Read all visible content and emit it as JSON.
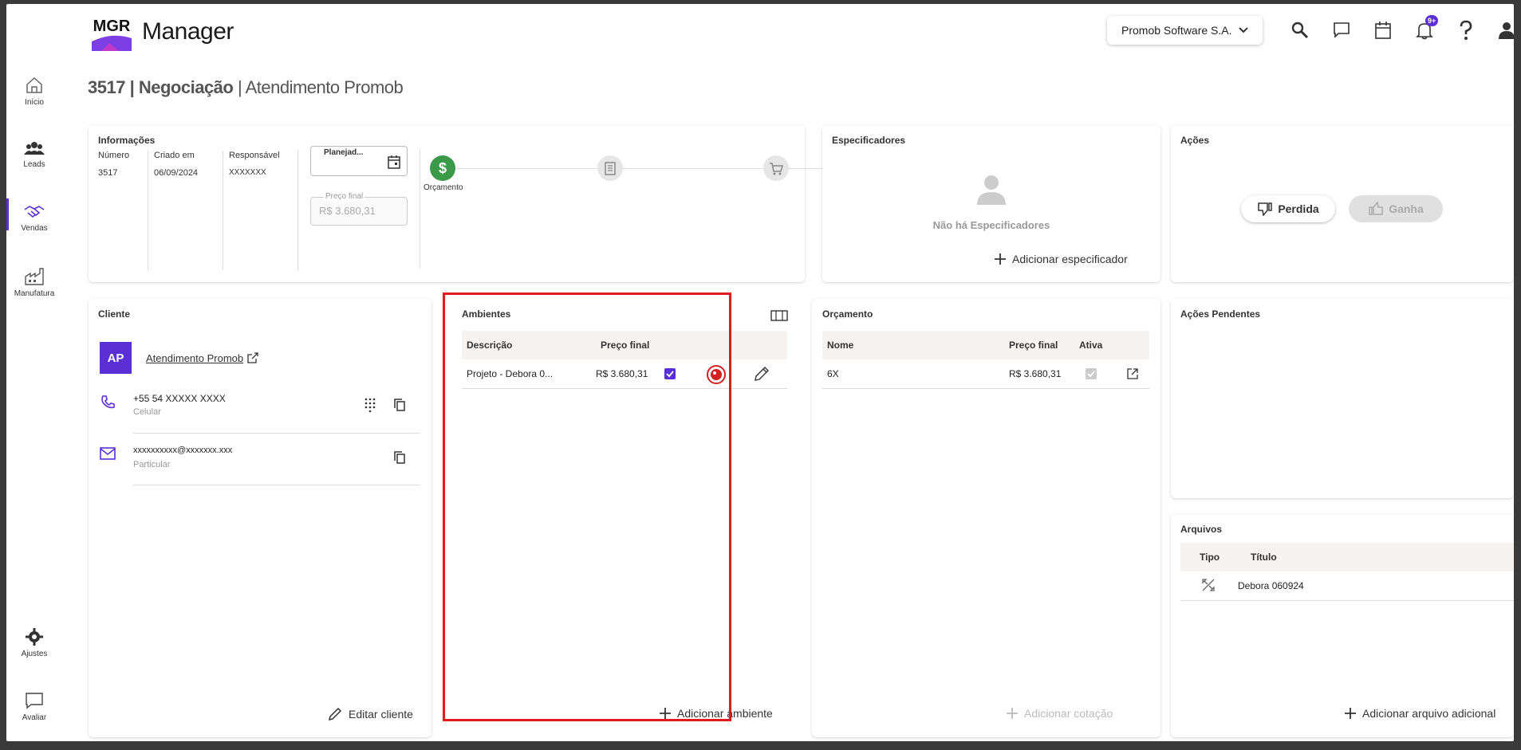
{
  "app": {
    "logo_text": "MGR",
    "title": "Manager"
  },
  "header": {
    "company": "Promob Software S.A.",
    "notifications_badge": "9+"
  },
  "nav": [
    {
      "label": "Início"
    },
    {
      "label": "Leads"
    },
    {
      "label": "Vendas"
    },
    {
      "label": "Manufatura"
    },
    {
      "label": "Ajustes"
    },
    {
      "label": "Avaliar"
    }
  ],
  "page": {
    "id": "3517",
    "separator1": " | ",
    "stage": "Negociação",
    "separator2": " | ",
    "name": "Atendimento Promob"
  },
  "info": {
    "title": "Informações",
    "numero_label": "Número",
    "numero": "3517",
    "criado_label": "Criado em",
    "criado": "06/09/2024",
    "responsavel_label": "Responsável",
    "responsavel": "XXXXXXX",
    "date_field": "Planejad...",
    "preco_label": "Preço final",
    "preco": "R$ 3.680,31",
    "step1_label": "Orçamento"
  },
  "especificadores": {
    "title": "Especificadores",
    "empty": "Não há Especificadores",
    "add": "Adicionar especificador"
  },
  "acoes": {
    "title": "Ações",
    "perdida": "Perdida",
    "ganha": "Ganha"
  },
  "cliente": {
    "title": "Cliente",
    "initials": "AP",
    "name": "Atendimento Promob",
    "phone": "+55 54 XXXXX XXXX",
    "phone_type": "Celular",
    "email": "xxxxxxxxxx@xxxxxxx.xxx",
    "email_type": "Particular",
    "edit": "Editar cliente"
  },
  "ambientes": {
    "title": "Ambientes",
    "col_desc": "Descrição",
    "col_preco": "Preço final",
    "rows": [
      {
        "desc": "Projeto - Debora 0...",
        "preco": "R$ 3.680,31"
      }
    ],
    "add": "Adicionar ambiente"
  },
  "orcamento": {
    "title": "Orçamento",
    "col_nome": "Nome",
    "col_preco": "Preço final",
    "col_ativa": "Ativa",
    "rows": [
      {
        "nome": "6X",
        "preco": "R$ 3.680,31"
      }
    ],
    "add": "Adicionar cotação"
  },
  "pendentes": {
    "title": "Ações Pendentes"
  },
  "arquivos": {
    "title": "Arquivos",
    "col_tipo": "Tipo",
    "col_titulo": "Título",
    "rows": [
      {
        "titulo": "Debora 060924"
      }
    ],
    "add": "Adicionar arquivo adicional"
  },
  "colors": {
    "accent": "#5b2fd6",
    "success": "#3a9a4a",
    "highlight": "#e01b1b"
  }
}
